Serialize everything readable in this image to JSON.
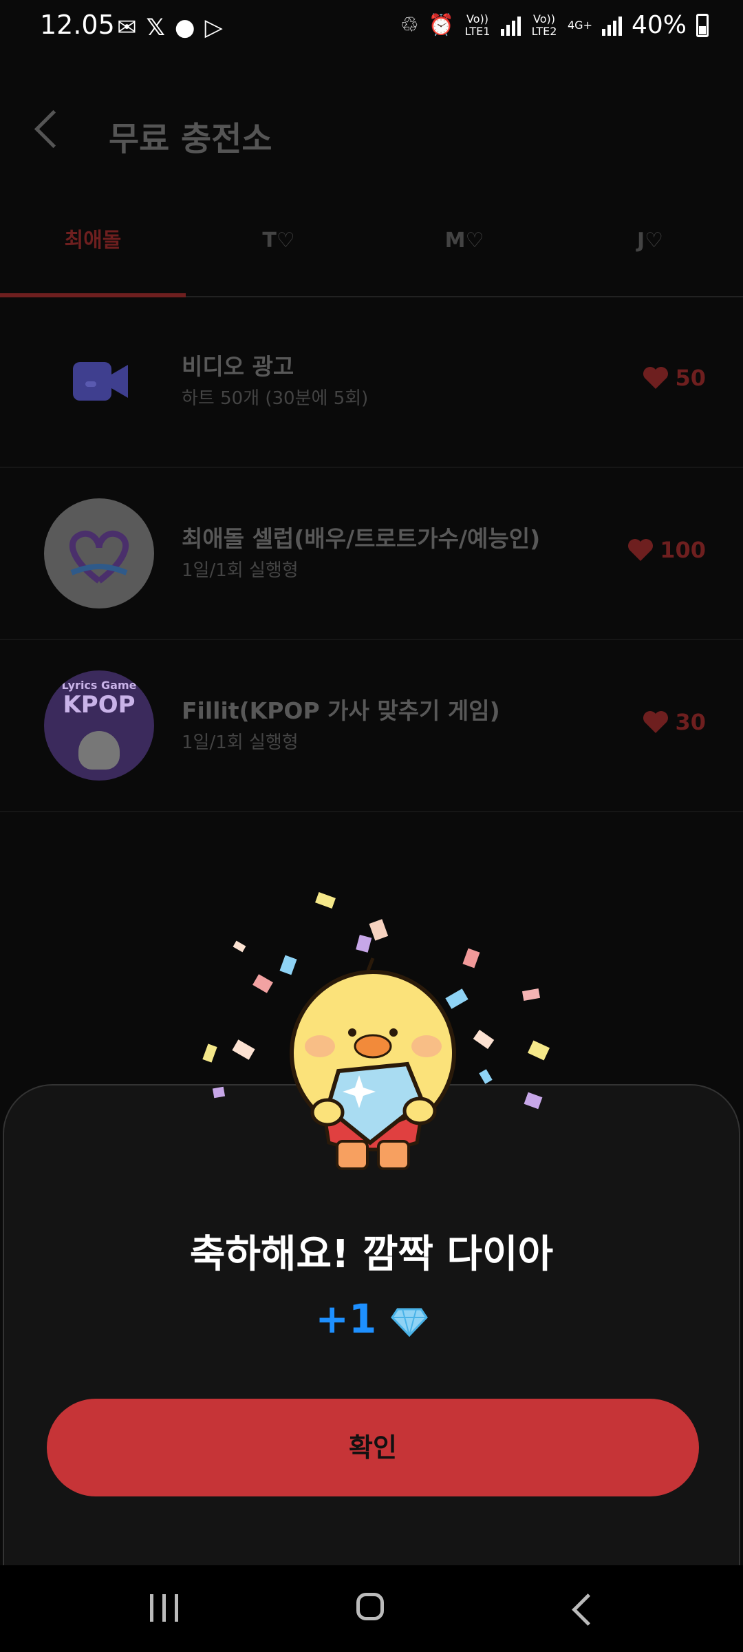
{
  "status_bar": {
    "time": "12.05",
    "net1": "Vo)) LTE1",
    "net2": "Vo)) LTE2",
    "net3": "4G+",
    "battery": "40%"
  },
  "header": {
    "title": "무료 충전소"
  },
  "tabs": [
    {
      "label": "최애돌"
    },
    {
      "label": "T♡"
    },
    {
      "label": "M♡"
    },
    {
      "label": "J♡"
    }
  ],
  "list": [
    {
      "title": "비디오 광고",
      "subtitle": "하트 50개 (30분에 5회)",
      "reward": "50"
    },
    {
      "title": "최애돌 셀럽(배우/트로트가수/예능인)",
      "subtitle": "1일/1회 실행형",
      "reward": "100"
    },
    {
      "title": "Fillit(KPOP 가사 맞추기 게임)",
      "subtitle": "1일/1회 실행형",
      "reward": "30"
    }
  ],
  "kpop_icon": {
    "line1": "Lyrics Game",
    "line2": "KPOP"
  },
  "sheet": {
    "title": "축하해요! 깜짝 다이아",
    "reward": "+1",
    "confirm_label": "확인"
  },
  "colors": {
    "accent": "#c63437",
    "diamond_blue": "#1e90ff",
    "background": "#0a0a0a"
  }
}
